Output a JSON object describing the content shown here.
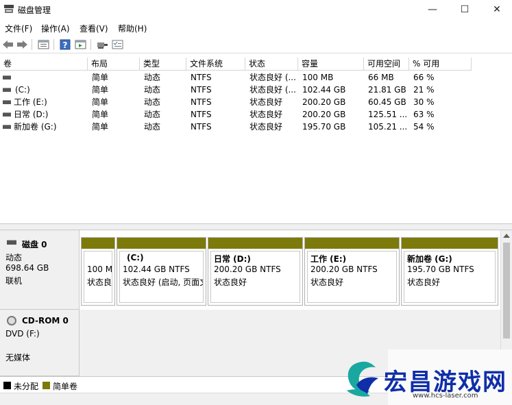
{
  "window": {
    "title": "磁盘管理",
    "minimize": "—",
    "maximize": "☐",
    "close": "✕"
  },
  "menu": [
    "文件(F)",
    "操作(A)",
    "查看(V)",
    "帮助(H)"
  ],
  "toolbar": {
    "buttons": [
      "back-icon",
      "forward-icon",
      "disk-list-icon",
      "help-icon",
      "properties-icon",
      "connect-icon",
      "checklist-icon"
    ]
  },
  "volume_table": {
    "columns": [
      "卷",
      "布局",
      "类型",
      "文件系统",
      "状态",
      "容量",
      "可用空间",
      "% 可用"
    ],
    "rows": [
      [
        "",
        "简单",
        "动态",
        "NTFS",
        "状态良好 (...",
        "100 MB",
        "66 MB",
        "66 %"
      ],
      [
        "(C:)",
        "简单",
        "动态",
        "NTFS",
        "状态良好 (...",
        "102.44 GB",
        "21.81 GB",
        "21 %"
      ],
      [
        "工作 (E:)",
        "简单",
        "动态",
        "NTFS",
        "状态良好",
        "200.20 GB",
        "60.45 GB",
        "30 %"
      ],
      [
        "日常 (D:)",
        "简单",
        "动态",
        "NTFS",
        "状态良好",
        "200.20 GB",
        "125.51 ...",
        "63 %"
      ],
      [
        "新加卷 (G:)",
        "简单",
        "动态",
        "NTFS",
        "状态良好",
        "195.70 GB",
        "105.21 ...",
        "54 %"
      ]
    ]
  },
  "disk0": {
    "name": "磁盘 0",
    "type": "动态",
    "size": "698.64 GB",
    "state": "联机",
    "partitions": [
      {
        "name": "",
        "size": "100 M",
        "status": "状态良"
      },
      {
        "name": "(C:)",
        "size": "102.44 GB NTFS",
        "status": "状态良好 (启动, 页面文"
      },
      {
        "name": "日常 (D:)",
        "size": "200.20 GB NTFS",
        "status": "状态良好"
      },
      {
        "name": "工作 (E:)",
        "size": "200.20 GB NTFS",
        "status": "状态良好"
      },
      {
        "name": "新加卷 (G:)",
        "size": "195.70 GB NTFS",
        "status": "状态良好"
      }
    ]
  },
  "cdrom0": {
    "name": "CD-ROM 0",
    "drive": "DVD (F:)",
    "media": "无媒体"
  },
  "legend": {
    "unallocated": "未分配",
    "simple": "简单卷",
    "unallocated_color": "#000000",
    "simple_color": "#7c7a0a"
  },
  "watermark": {
    "title": "宏昌游戏网",
    "url": "www.hcs-laser.com"
  }
}
